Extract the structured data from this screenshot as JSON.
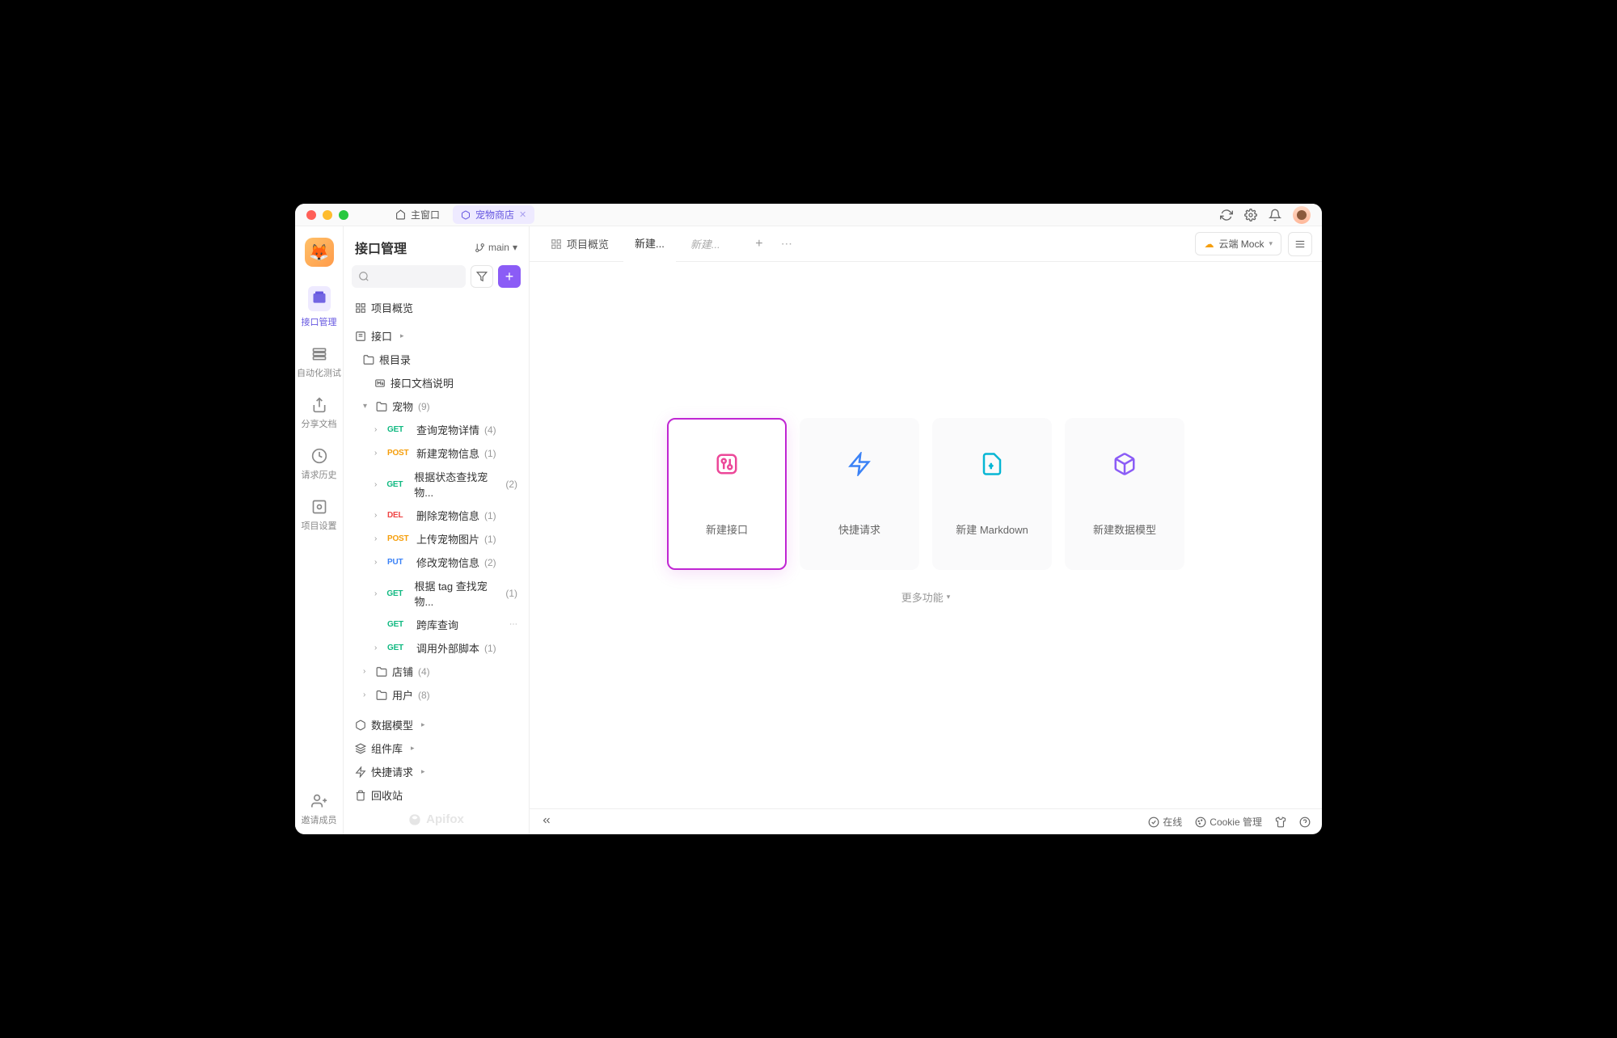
{
  "window": {
    "home_tab": "主窗口",
    "project_tab": "宠物商店"
  },
  "sidebar_rail": [
    {
      "label": "接口管理",
      "active": true
    },
    {
      "label": "自动化测试",
      "active": false
    },
    {
      "label": "分享文档",
      "active": false
    },
    {
      "label": "请求历史",
      "active": false
    },
    {
      "label": "项目设置",
      "active": false
    }
  ],
  "rail_bottom": {
    "label": "邀请成员"
  },
  "sidebar": {
    "title": "接口管理",
    "branch": "main",
    "project_overview": "项目概览",
    "tree": {
      "api_root": "接口",
      "root_folder": "根目录",
      "doc": "接口文档说明",
      "pets_folder": "宠物",
      "pets_count": "(9)",
      "endpoints": [
        {
          "method": "GET",
          "name": "查询宠物详情",
          "count": "(4)"
        },
        {
          "method": "POST",
          "name": "新建宠物信息",
          "count": "(1)"
        },
        {
          "method": "GET",
          "name": "根据状态查找宠物...",
          "count": "(2)"
        },
        {
          "method": "DEL",
          "name": "删除宠物信息",
          "count": "(1)"
        },
        {
          "method": "POST",
          "name": "上传宠物图片",
          "count": "(1)"
        },
        {
          "method": "PUT",
          "name": "修改宠物信息",
          "count": "(2)"
        },
        {
          "method": "GET",
          "name": "根据 tag 查找宠物...",
          "count": "(1)"
        },
        {
          "method": "GET",
          "name": "跨库查询",
          "count": ""
        },
        {
          "method": "GET",
          "name": "调用外部脚本",
          "count": "(1)"
        }
      ],
      "store_folder": "店铺",
      "store_count": "(4)",
      "user_folder": "用户",
      "user_count": "(8)",
      "data_model": "数据模型",
      "component_lib": "组件库",
      "quick_request": "快捷请求",
      "recycle_bin": "回收站"
    },
    "brand": "Apifox"
  },
  "tabs": {
    "overview": "项目概览",
    "new_tab": "新建...",
    "placeholder": "新建...",
    "mock": "云端 Mock"
  },
  "cards": [
    {
      "label": "新建接口",
      "selected": true
    },
    {
      "label": "快捷请求",
      "selected": false
    },
    {
      "label": "新建 Markdown",
      "selected": false
    },
    {
      "label": "新建数据模型",
      "selected": false
    }
  ],
  "more": "更多功能",
  "footer": {
    "online": "在线",
    "cookie": "Cookie 管理"
  }
}
